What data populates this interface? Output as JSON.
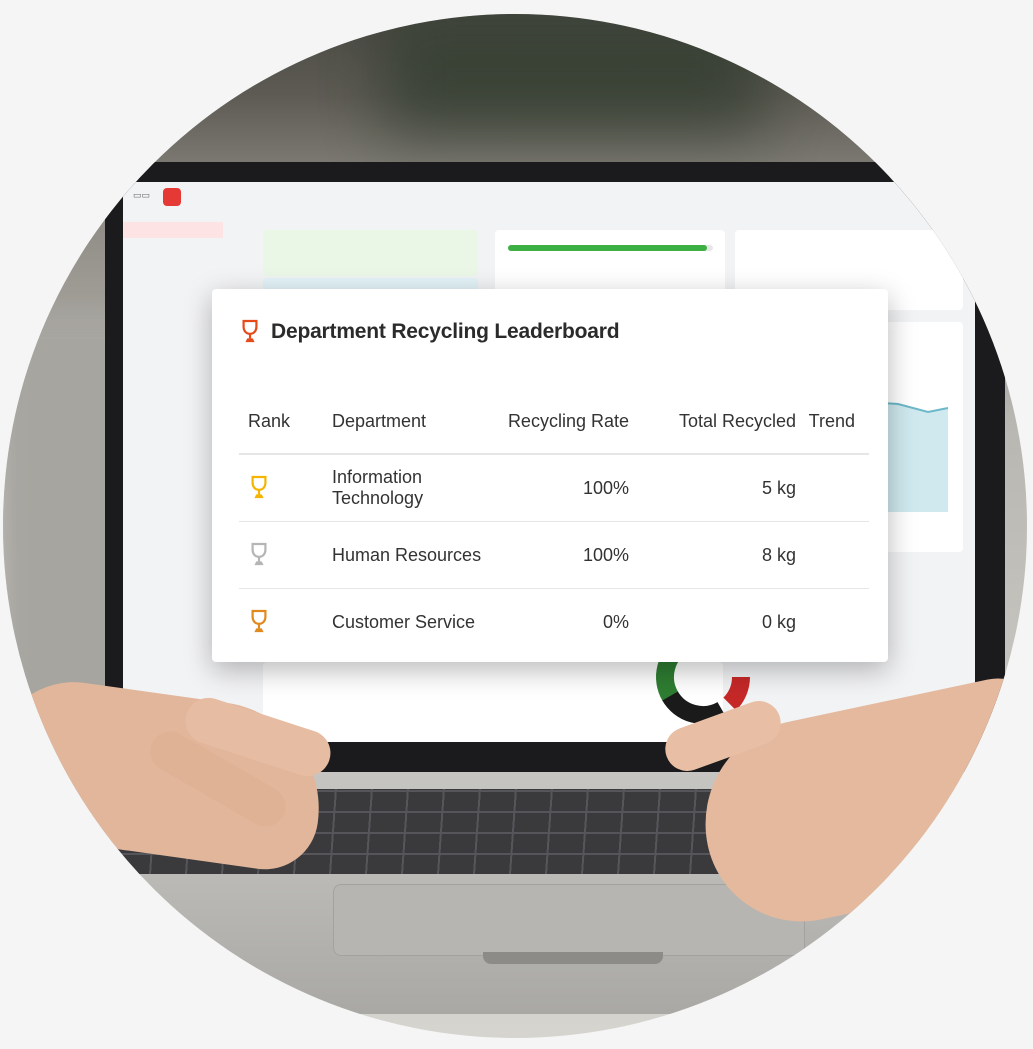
{
  "leaderboard": {
    "title": "Department Recycling Leaderboard",
    "title_icon": "trophy-icon",
    "title_icon_color": "#e64a19",
    "columns": [
      "Rank",
      "Department",
      "Recycling Rate",
      "Total Recycled",
      "Trend"
    ],
    "rows": [
      {
        "rank_icon": "gold-trophy-icon",
        "rank_color": "#f5b400",
        "department": "Information Technology",
        "rate": "100%",
        "total": "5 kg",
        "trend": ""
      },
      {
        "rank_icon": "silver-trophy-icon",
        "rank_color": "#b5b5b5",
        "department": "Human Resources",
        "rate": "100%",
        "total": "8 kg",
        "trend": ""
      },
      {
        "rank_icon": "bronze-trophy-icon",
        "rank_color": "#e08a1e",
        "department": "Customer Service",
        "rate": "0%",
        "total": "0 kg",
        "trend": ""
      }
    ]
  },
  "background_dashboard": {
    "brand_color": "#e53935",
    "progress_fill": 0.97,
    "progress_color": "#3cb043"
  }
}
